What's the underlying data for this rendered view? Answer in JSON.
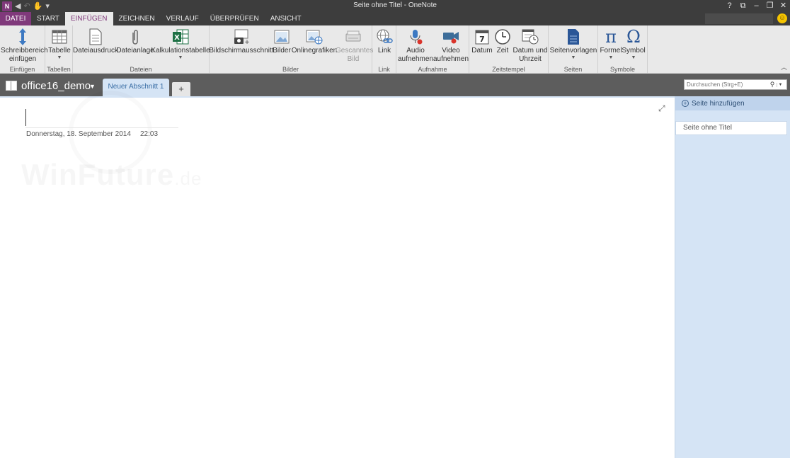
{
  "window": {
    "title": "Seite ohne Titel - OneNote",
    "app_logo": "N",
    "controls": [
      "?",
      "⧉",
      "–",
      "❐",
      "✕"
    ]
  },
  "ribbon_tabs": [
    "DATEI",
    "START",
    "EINFÜGEN",
    "ZEICHNEN",
    "VERLAUF",
    "ÜBERPRÜFEN",
    "ANSICHT"
  ],
  "ribbon": {
    "groups": {
      "einfuegen": "Einfügen",
      "tabellen": "Tabellen",
      "dateien": "Dateien",
      "bilder": "Bilder",
      "link": "Link",
      "aufnahme": "Aufnahme",
      "zeitstempel": "Zeitstempel",
      "seiten": "Seiten",
      "symbole": "Symbole"
    },
    "buttons": {
      "schreibbereich": "Schreibbereich einfügen",
      "tabelle": "Tabelle",
      "dateiausdruck": "Dateiausdruck",
      "dateianlage": "Dateianlage",
      "kalkulationstabelle": "Kalkulationstabelle",
      "bildschirmausschnitt": "Bildschirmausschnitt",
      "bilder": "Bilder",
      "onlinegrafiken": "Onlinegrafiken",
      "gescanntes_bild": "Gescanntes Bild",
      "link": "Link",
      "audio": "Audio aufnehmen",
      "video": "Video aufnehmen",
      "datum": "Datum",
      "datum_icon": "7",
      "zeit": "Zeit",
      "datum_uhrzeit": "Datum und Uhrzeit",
      "seitenvorlagen": "Seitenvorlagen",
      "formel": "Formel",
      "symbol": "Symbol"
    }
  },
  "notebook": {
    "name": "office16_demo",
    "section": "Neuer Abschnitt 1",
    "add_section": "+"
  },
  "search": {
    "placeholder": "Durchsuchen (Strg+E)"
  },
  "page": {
    "date": "Donnerstag, 18. September 2014",
    "time": "22:03",
    "watermark": "WinFuture",
    "watermark_suffix": ".de"
  },
  "pages_panel": {
    "add_label": "Seite hinzufügen",
    "pages": [
      "Seite ohne Titel"
    ]
  },
  "colors": {
    "accent": "#80397b",
    "section": "#d5e4f5",
    "chrome": "#3d3d3d"
  }
}
